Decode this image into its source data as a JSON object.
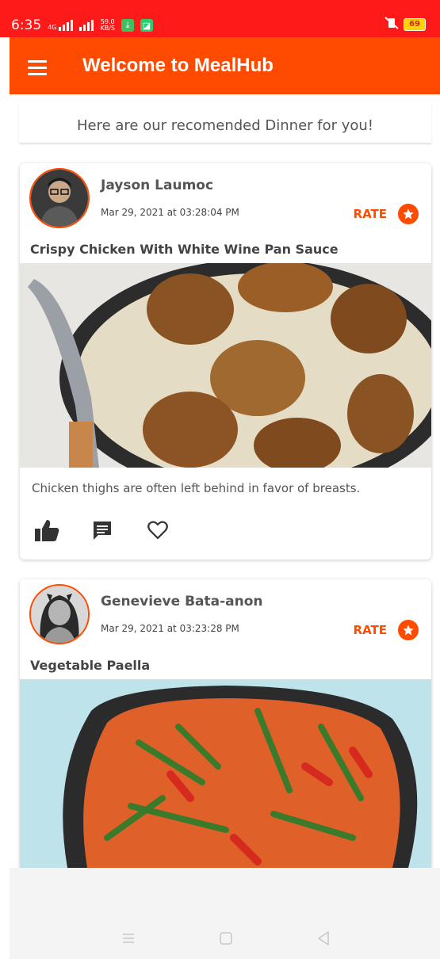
{
  "status_bar": {
    "time": "6:35",
    "network": "4G",
    "speed_value": "59.0",
    "speed_unit": "KB/S",
    "battery": "69"
  },
  "app_bar": {
    "title": "Welcome to MealHub",
    "menu_icon": "hamburger-menu-icon"
  },
  "subheader": {
    "text": "Here are our recomended Dinner for you!"
  },
  "posts": [
    {
      "author": "Jayson Laumoc",
      "date": "Mar 29, 2021 at 03:28:04 PM",
      "rate_label": "RATE",
      "title": "Crispy Chicken With White Wine Pan Sauce",
      "description": "Chicken thighs are often left behind in favor of breasts.",
      "actions": [
        "thumbs-up-icon",
        "comment-icon",
        "heart-icon"
      ]
    },
    {
      "author": "Genevieve Bata-anon",
      "date": "Mar 29, 2021 at 03:23:28 PM",
      "rate_label": "RATE",
      "title": "Vegetable Paella"
    }
  ],
  "colors": {
    "status_bar": "#ff1a1a",
    "accent": "#ff4b00",
    "text": "#555555"
  }
}
